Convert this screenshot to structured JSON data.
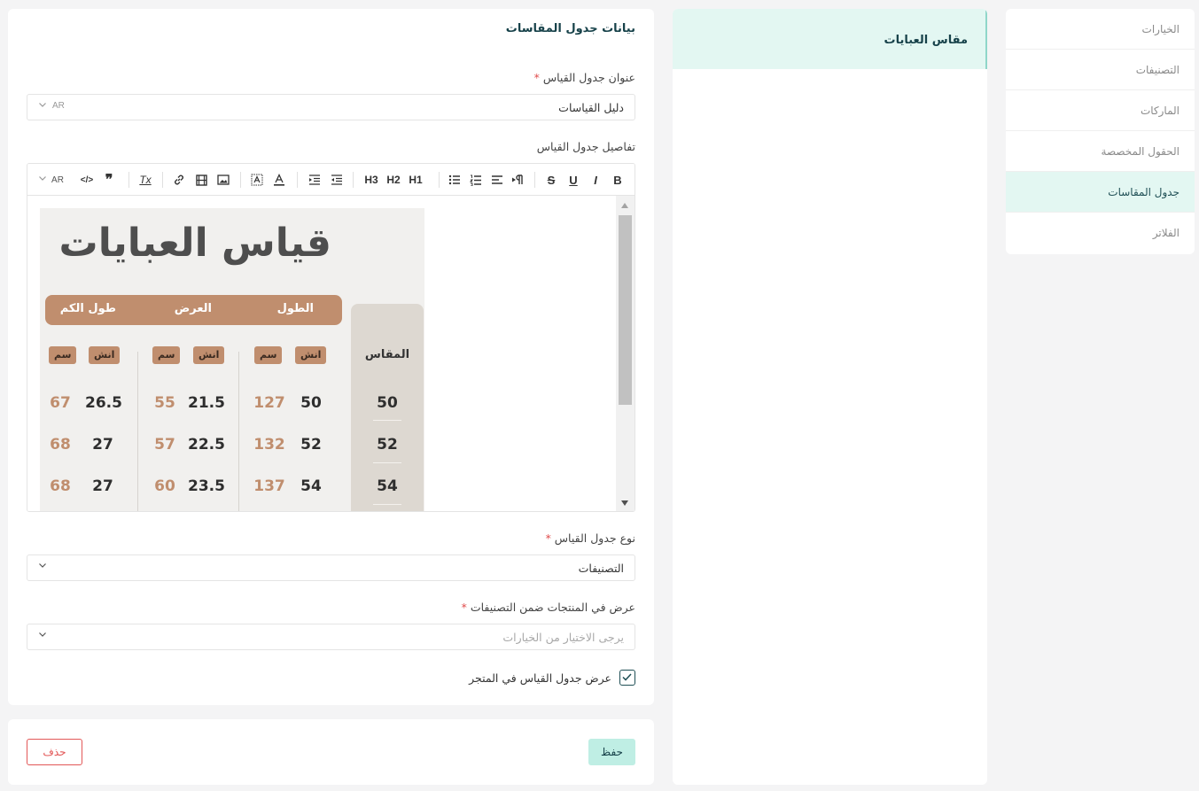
{
  "sidebar": {
    "items": [
      {
        "label": "الخيارات",
        "active": false
      },
      {
        "label": "التصنيفات",
        "active": false
      },
      {
        "label": "الماركات",
        "active": false
      },
      {
        "label": "الحقول المخصصة",
        "active": false
      },
      {
        "label": "جدول المقاسات",
        "active": true
      },
      {
        "label": "الفلاتر",
        "active": false
      }
    ]
  },
  "list": {
    "items": [
      {
        "label": "مقاس العبايات",
        "active": true
      }
    ]
  },
  "form": {
    "title": "بيانات جدول المقاسات",
    "name_label": "عنوان جدول القياس",
    "name_value": "دليل القياسات",
    "lang": "AR",
    "details_label": "تفاصيل جدول القياس",
    "editor_lang": "AR",
    "toolbar": {
      "bold": "B",
      "italic": "I",
      "underline": "U",
      "strike": "S",
      "h1": "H1",
      "h2": "H2",
      "h3": "H3",
      "quote": "❞",
      "code": "</>",
      "clear": "Tx"
    },
    "size_chart": {
      "title": "قياس العبايات",
      "size_header": "المقاس",
      "col_length": "الطول",
      "col_width": "العرض",
      "col_sleeve": "طول الكم",
      "unit_inch": "انش",
      "unit_cm": "سم",
      "sizes": [
        "50",
        "52",
        "54"
      ],
      "length_in": [
        "50",
        "52",
        "54"
      ],
      "length_cm": [
        "127",
        "132",
        "137"
      ],
      "width_in": [
        "21.5",
        "22.5",
        "23.5"
      ],
      "width_cm": [
        "55",
        "57",
        "60"
      ],
      "sleeve_in": [
        "26.5",
        "27",
        "27"
      ],
      "sleeve_cm": [
        "67",
        "68",
        "68"
      ]
    },
    "type_label": "نوع جدول القياس",
    "type_value": "التصنيفات",
    "show_label": "عرض في المنتجات ضمن التصنيفات",
    "show_placeholder": "يرجى الاختيار من الخيارات",
    "store_checkbox_label": "عرض جدول القياس في المتجر",
    "store_checkbox_checked": true,
    "required_mark": "*"
  },
  "footer": {
    "save_label": "حفظ",
    "delete_label": "حذف"
  },
  "colors": {
    "accent": "#bfeee4",
    "active_bg": "#e3f7f2",
    "primary_text": "#17424a",
    "danger": "#e25757",
    "chart_brown": "#c08e6e"
  }
}
